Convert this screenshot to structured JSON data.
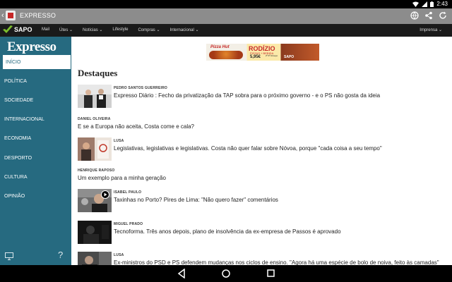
{
  "status_bar": {
    "time": "2:43"
  },
  "app_bar": {
    "title": "EXPRESSO"
  },
  "sapo_nav": {
    "logo": "SAPO",
    "items": [
      "Mail",
      "Útes ⌄",
      "Notícias ⌄",
      "Lifestyle",
      "Compras ⌄",
      "Internacional ⌄"
    ],
    "right": "Imprensa ⌄"
  },
  "sidebar": {
    "brand": "Expresso",
    "items": [
      "INÍCIO",
      "POLÍTICA",
      "SOCIEDADE",
      "INTERNACIONAL",
      "ECONOMIA",
      "DESPORTO",
      "CULTURA",
      "OPINIÃO"
    ],
    "help": "?"
  },
  "ad": {
    "brand": "Pizza Hut",
    "title": "RODÍZIO",
    "subtitle": "PIZZAS + BEBIDA",
    "price": "5,95€",
    "note": "2ª-6ª Almoço",
    "sapo": "SAPO"
  },
  "main": {
    "section_title": "Destaques",
    "articles": [
      {
        "author": "PEDRO SANTOS GUERREIRO",
        "headline": "Expresso Diário : Fecho da privatização da TAP sobra para o próximo governo - e o PS não gosta da ideia",
        "has_thumb": true
      },
      {
        "author": "DANIEL OLIVEIRA",
        "headline": "E se a Europa não aceita, Costa come e cala?",
        "has_thumb": false
      },
      {
        "author": "LUSA",
        "headline": "Legislativas, legislativas e legislativas. Costa não quer falar sobre Nóvoa, porque \"cada coisa a seu tempo\"",
        "has_thumb": true
      },
      {
        "author": "HENRIQUE RAPOSO",
        "headline": "Um exemplo para a minha geração",
        "has_thumb": false
      },
      {
        "author": "ISABEL PAULO",
        "headline": "Taxinhas no Porto? Pires de Lima: \"Não quero fazer\" comentários",
        "has_thumb": true,
        "video": true
      },
      {
        "author": "MIGUEL PRADO",
        "headline": "Tecnoforma. Três anos depois, plano de insolvência da ex-empresa de Passos é aprovado",
        "has_thumb": true
      },
      {
        "author": "LUSA",
        "headline": "Ex-ministros do PSD e PS defendem mudanças nos ciclos de ensino. \"Agora há uma espécie de bolo de noiva, feito às camadas\"",
        "has_thumb": true
      }
    ]
  },
  "colors": {
    "sidebar": "#266a80",
    "app_bar": "#8c8c8c",
    "sapo_nav": "#1a1a1a"
  }
}
